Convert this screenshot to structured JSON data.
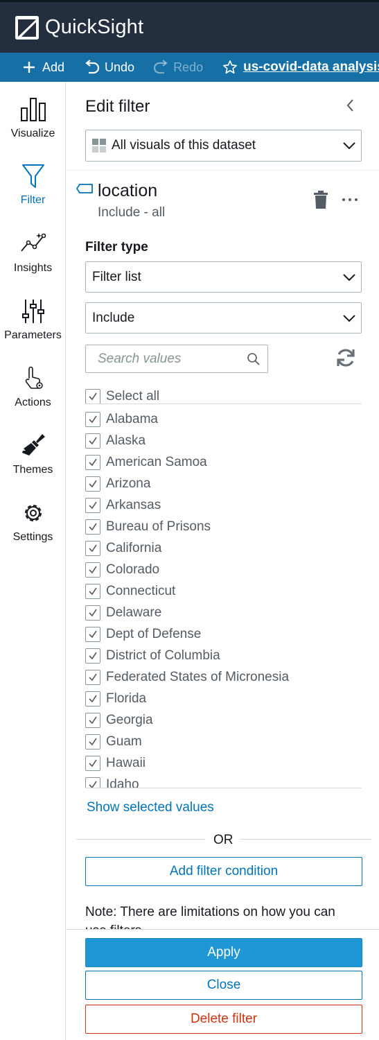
{
  "app": {
    "name": "QuickSight"
  },
  "toolbar": {
    "add_label": "Add",
    "undo_label": "Undo",
    "redo_label": "Redo",
    "analysis_title": "us-covid-data analysis"
  },
  "nav": {
    "items": [
      {
        "label": "Visualize",
        "icon": "bar-chart-icon"
      },
      {
        "label": "Filter",
        "icon": "funnel-icon",
        "active": true
      },
      {
        "label": "Insights",
        "icon": "insights-icon"
      },
      {
        "label": "Parameters",
        "icon": "sliders-icon"
      },
      {
        "label": "Actions",
        "icon": "pointer-gear-icon"
      },
      {
        "label": "Themes",
        "icon": "paintbrush-icon"
      },
      {
        "label": "Settings",
        "icon": "gear-icon"
      }
    ]
  },
  "panel": {
    "title": "Edit filter",
    "scope_select": "All visuals of this dataset",
    "field_name": "location",
    "field_summary": "Include - all",
    "filter_type_label": "Filter type",
    "filter_type_value": "Filter list",
    "mode_value": "Include",
    "search_placeholder": "Search values",
    "select_all_label": "Select all",
    "values": [
      "Alabama",
      "Alaska",
      "American Samoa",
      "Arizona",
      "Arkansas",
      "Bureau of Prisons",
      "California",
      "Colorado",
      "Connecticut",
      "Delaware",
      "Dept of Defense",
      "District of Columbia",
      "Federated States of Micronesia",
      "Florida",
      "Georgia",
      "Guam",
      "Hawaii",
      "Idaho"
    ],
    "show_selected_label": "Show selected values",
    "or_label": "OR",
    "add_condition_label": "Add filter condition",
    "note": "Note: There are limitations on how you can use filters",
    "apply_label": "Apply",
    "close_label": "Close",
    "delete_label": "Delete filter"
  },
  "colors": {
    "header_bg": "#232f3e",
    "toolbar_bg": "#1670a6",
    "accent": "#0073bb",
    "primary_button": "#1f97d4",
    "danger": "#d13212"
  }
}
